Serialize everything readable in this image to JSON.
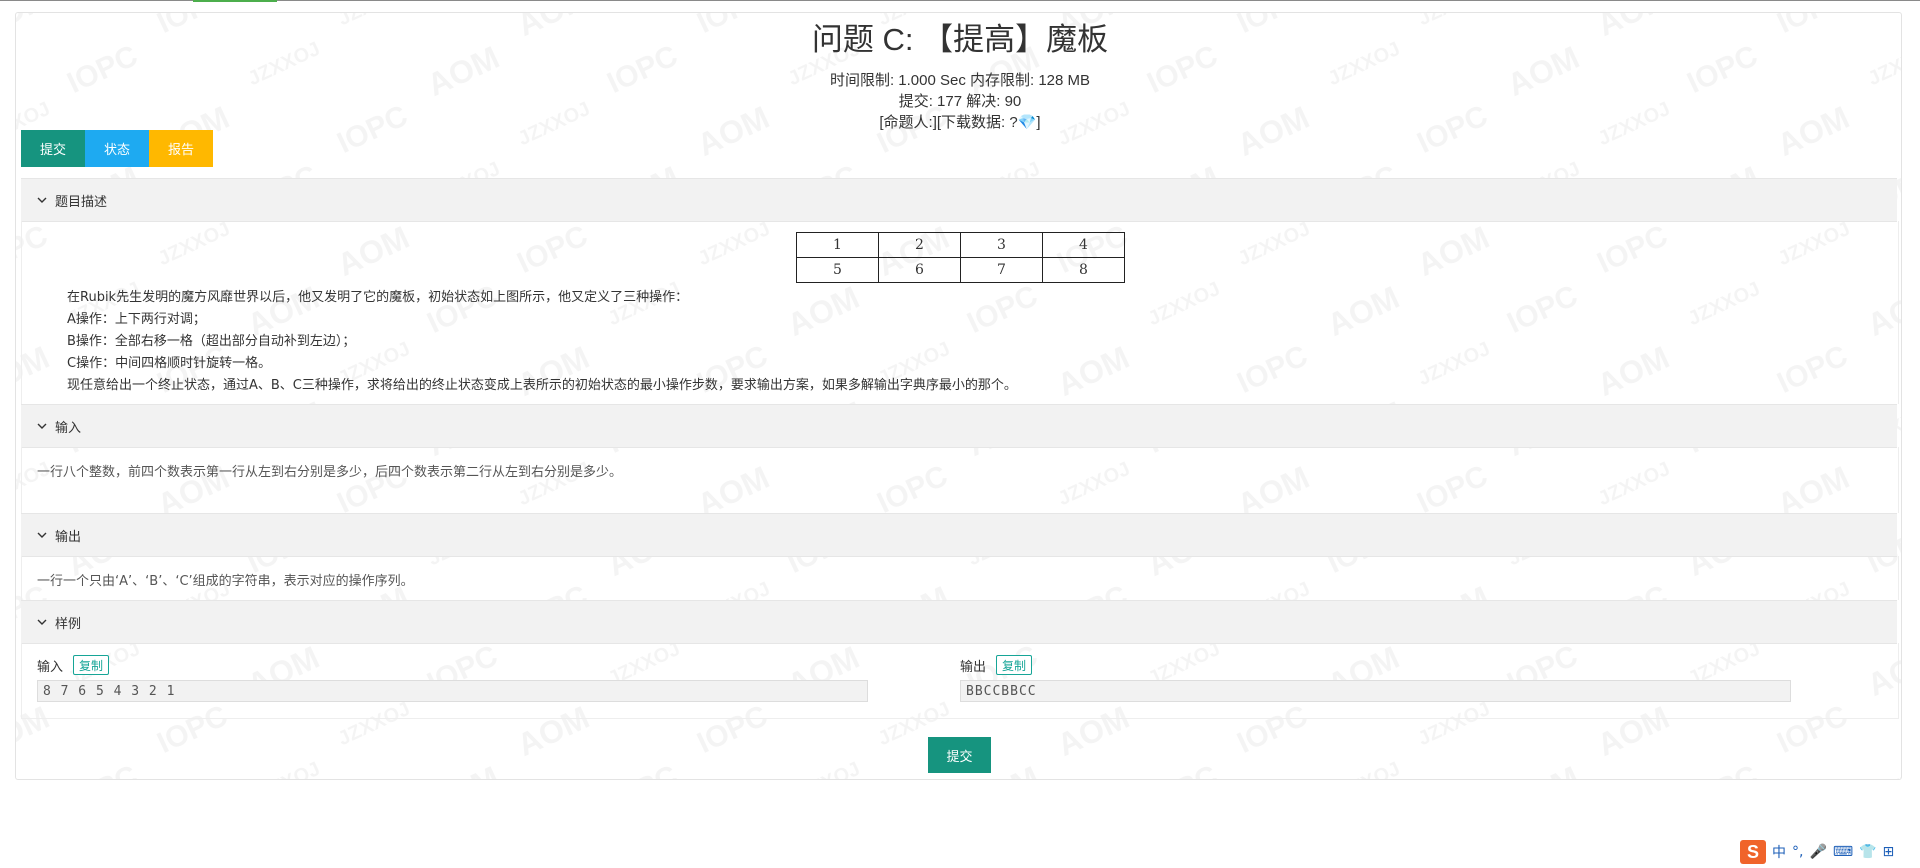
{
  "problem": {
    "title": "问题 C: 【提高】魔板",
    "limits": "时间限制: 1.000 Sec  内存限制: 128 MB",
    "stats": "提交: 177  解决: 90",
    "author_line": "[命题人:][下载数据: ?💎]"
  },
  "actions": {
    "submit": "提交",
    "status": "状态",
    "report": "报告"
  },
  "watermark": [
    "AOM",
    "IOPC",
    "JZXXOJ"
  ],
  "sections": {
    "description": {
      "heading": "题目描述",
      "grid": [
        [
          "1",
          "2",
          "3",
          "4"
        ],
        [
          "5",
          "6",
          "7",
          "8"
        ]
      ],
      "lines": [
        "在Rubik先生发明的魔方风靡世界以后，他又发明了它的魔板，初始状态如上图所示，他又定义了三种操作：",
        "A操作：上下两行对调；",
        "B操作：全部右移一格（超出部分自动补到左边）；",
        "C操作：中间四格顺时针旋转一格。",
        "现任意给出一个终止状态，通过A、B、C三种操作，求将给出的终止状态变成上表所示的初始状态的最小操作步数，要求输出方案，如果多解输出字典序最小的那个。"
      ]
    },
    "input": {
      "heading": "输入",
      "text": "一行八个整数，前四个数表示第一行从左到右分别是多少，后四个数表示第二行从左到右分别是多少。"
    },
    "output": {
      "heading": "输出",
      "text": "一行一个只由‘A’、‘B’、‘C’组成的字符串，表示对应的操作序列。"
    },
    "sample": {
      "heading": "样例",
      "input_label": "输入",
      "output_label": "输出",
      "copy_label": "复制",
      "input_value": "8 7 6 5 4 3 2 1",
      "output_value": "BBCCBBCC"
    }
  },
  "bottom_submit": "提交",
  "ime": {
    "logo": "S",
    "lang": "中",
    "punct": "°,",
    "mic": "🎤",
    "keyboard": "⌨",
    "skin": "👕",
    "grid": "⊞"
  },
  "colors": {
    "submit": "#16947f",
    "status": "#1eaaf1",
    "report": "#ffb800",
    "copy": "#16a597"
  }
}
